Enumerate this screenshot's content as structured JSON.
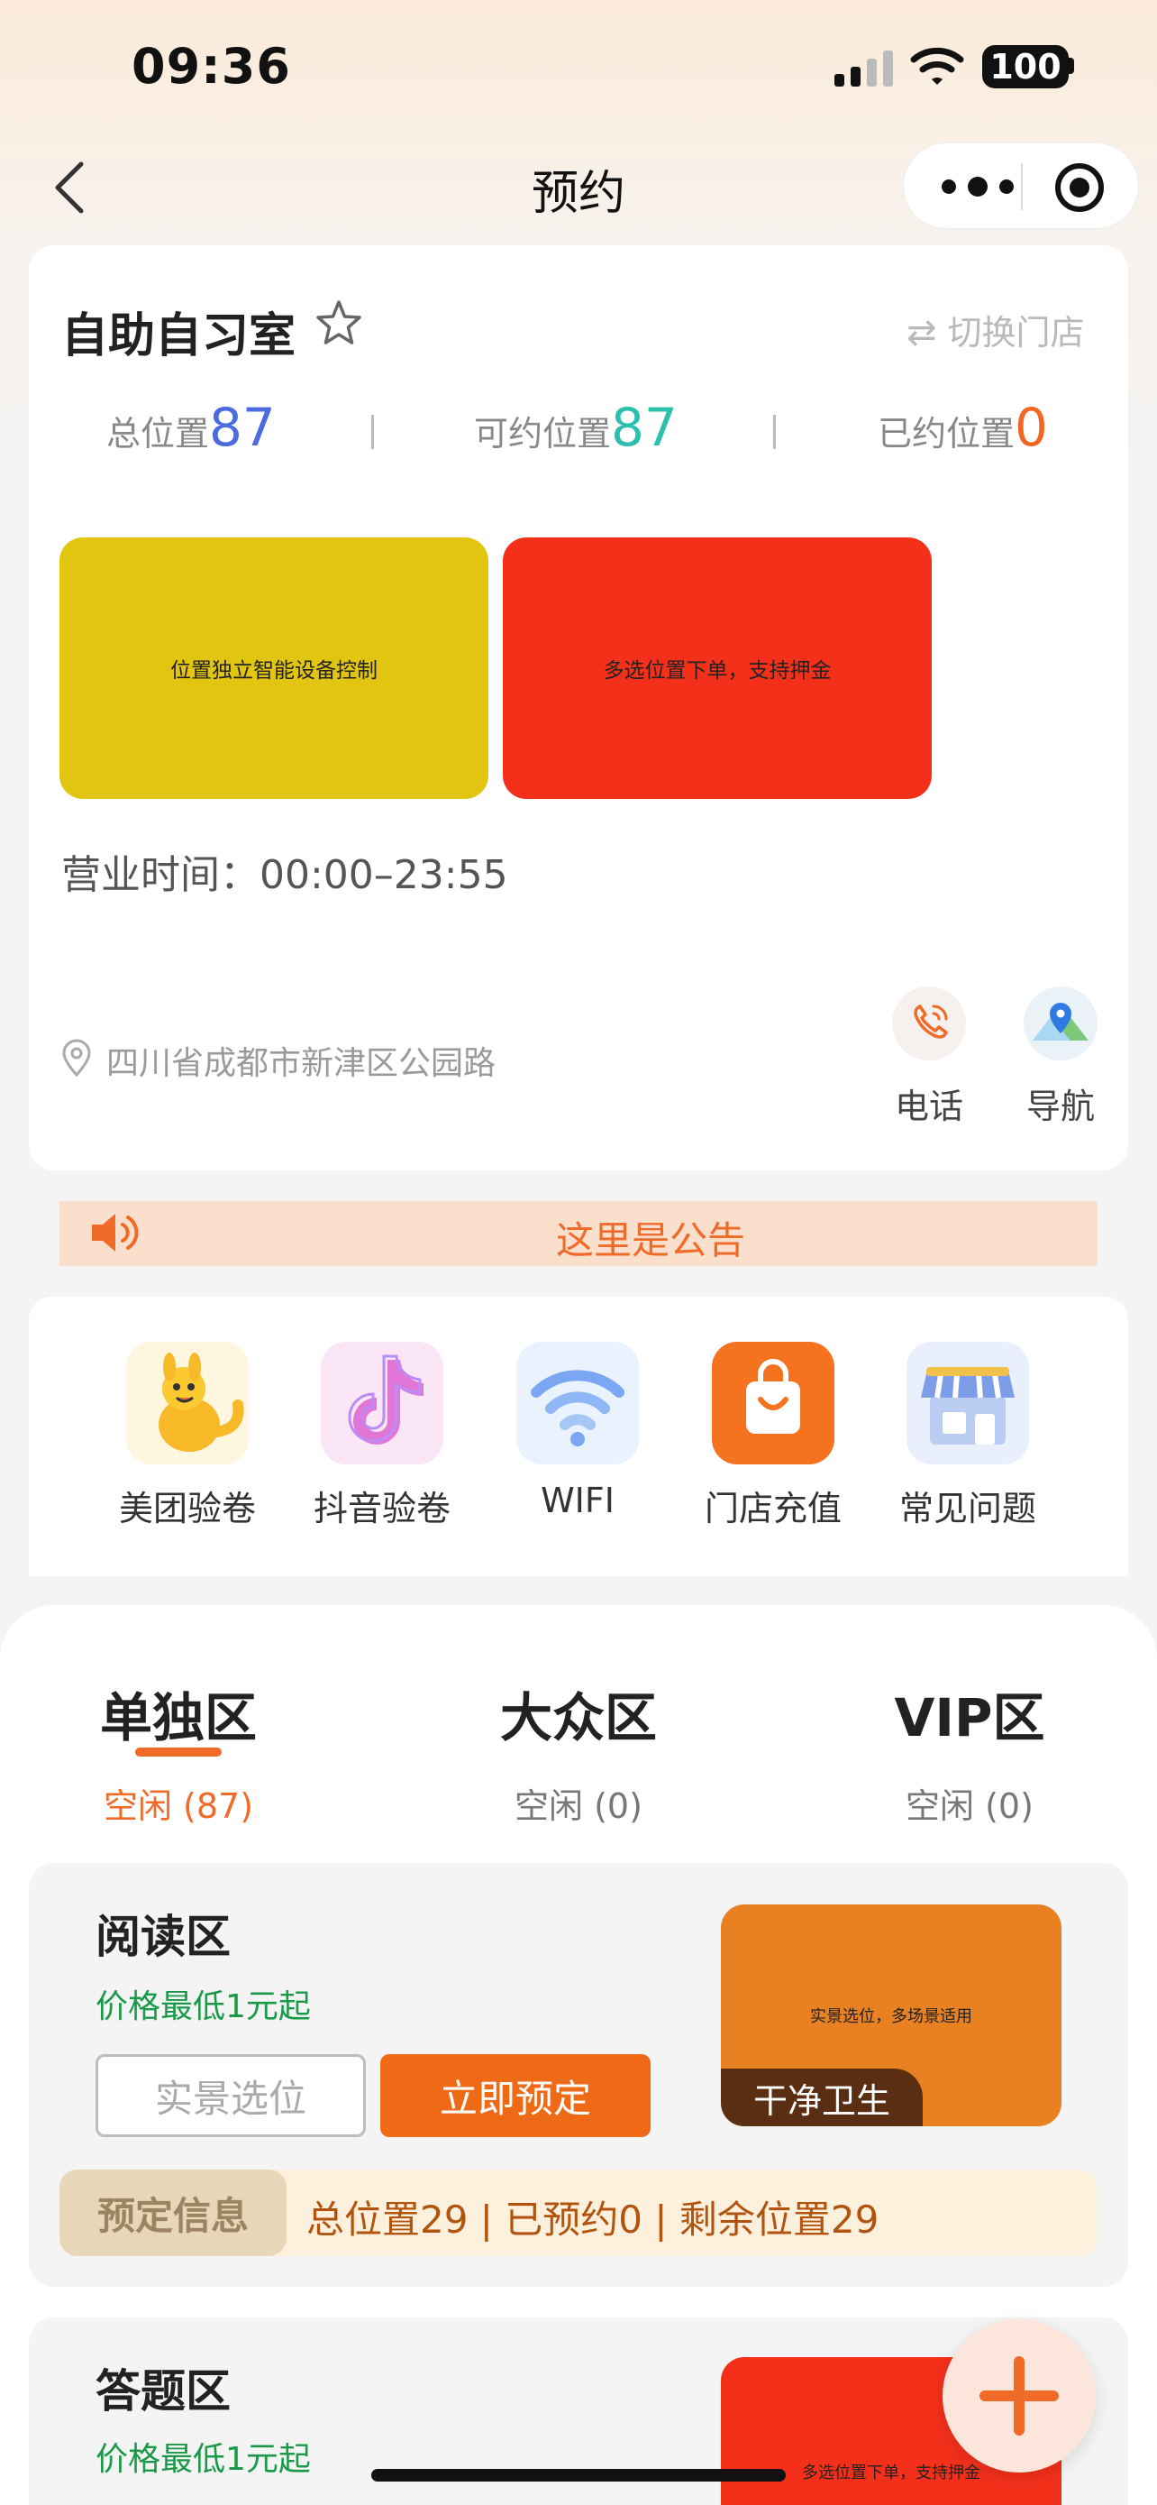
{
  "status_bar": {
    "time": "09:36",
    "battery": "100"
  },
  "nav": {
    "title": "预约"
  },
  "store": {
    "name": "自助自习室",
    "switch_label": "切换门店",
    "stats": [
      {
        "label": "总位置",
        "value": "87",
        "color": "#4A6CE0"
      },
      {
        "label": "可约位置",
        "value": "87",
        "color": "#2DBFAE"
      },
      {
        "label": "已约位置",
        "value": "0",
        "color": "#F26522"
      }
    ],
    "banners": [
      "位置独立智能设备控制",
      "多选位置下单，支持押金"
    ],
    "hours": "营业时间：00:00–23:55",
    "address": "四川省成都市新津区公园路",
    "actions": {
      "phone": "电话",
      "navigate": "导航"
    }
  },
  "notice": {
    "text": "这里是公告"
  },
  "services": [
    {
      "label": "美团验卷",
      "icon": "meituan-icon"
    },
    {
      "label": "抖音验卷",
      "icon": "douyin-icon"
    },
    {
      "label": "WIFI",
      "icon": "wifi-icon"
    },
    {
      "label": "门店充值",
      "icon": "recharge-bag-icon"
    },
    {
      "label": "常见问题",
      "icon": "store-awning-icon"
    }
  ],
  "zones": [
    {
      "name": "单独区",
      "status": "空闲 (87)",
      "active": true
    },
    {
      "name": "大众区",
      "status": "空闲 (0)",
      "active": false
    },
    {
      "name": "VIP区",
      "status": "空闲 (0)",
      "active": false
    }
  ],
  "areas": [
    {
      "title": "阅读区",
      "price": "价格最低1元起",
      "btn_view": "实景选位",
      "btn_book": "立即预定",
      "image_text": "实景选位，多场景适用",
      "tag": "干净卫生",
      "book_label": "预定信息",
      "book_info": "总位置29 | 已预约0 | 剩余位置29"
    },
    {
      "title": "答题区",
      "price": "价格最低1元起",
      "image_text": "多选位置下单，支持押金"
    }
  ]
}
